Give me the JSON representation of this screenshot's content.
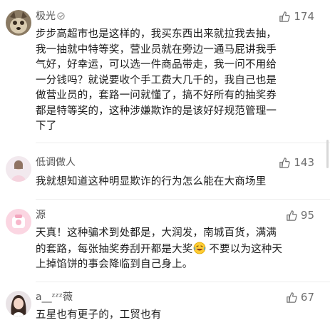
{
  "comments": [
    {
      "username": "极光",
      "likes": "174",
      "text": "步步高超市也是这样的，我买东西出来就拉我去抽，\n我一抽就中特等奖，营业员就在旁边一通马屁讲我手\n气好，好幸运，可以选一件商品带走，我一问不用给\n一分钱吗？就说要收个手工费大几千的，我自己也是\n做营业员的，套路一问就懂了，搞不好所有的抽奖券\n都是特等奖的，这种涉嫌欺诈的是该好好规范管理一\n下了"
    },
    {
      "username": "低调做人",
      "likes": "143",
      "text": "我就想知道这种明显欺诈的行为怎么能在大商场里"
    },
    {
      "username": "源",
      "likes": "95",
      "text_before_emoji": "天真！这种骗术到处都是，大润发，南城百货，满满\n的套路，每张抽奖券刮开都是大奖",
      "text_after_emoji": " 不要以为这种天\n上掉馅饼的事会降临到自己身上。"
    },
    {
      "username": "a__ᶻᶻᶻ薇",
      "likes": "67",
      "text": "五星也有更子的，工贸也有"
    }
  ],
  "colors": {
    "like_icon": "#707070",
    "username": "#555555",
    "text": "#1c1c1c"
  },
  "icons": [
    "thumbs-up-icon",
    "laughing-emoji-icon"
  ]
}
